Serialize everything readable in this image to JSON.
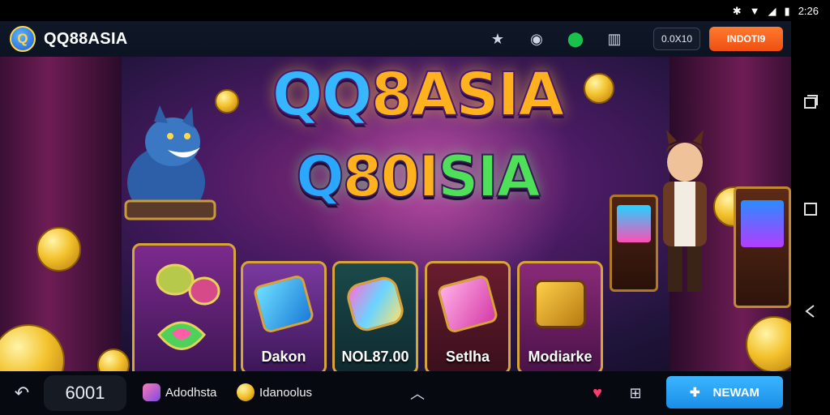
{
  "status_bar": {
    "time": "2:26",
    "icons": [
      "bluetooth-icon",
      "wifi-icon",
      "signal-icon",
      "battery-icon"
    ]
  },
  "header": {
    "logo_initial": "Q",
    "app_title": "QQ88ASIA",
    "icons": [
      "star-icon",
      "chat-icon",
      "notification-icon",
      "wallet-icon"
    ],
    "balance": "0.0X10",
    "deposit_label": "INDOTI9"
  },
  "hero": {
    "title_part1": "QQ",
    "title_part2": "8ASIA",
    "subtitle_part1": "Q",
    "subtitle_part2": "80I",
    "subtitle_part3": "SIA"
  },
  "games": [
    {
      "label": "Dakon",
      "icon": "blue-block-icon"
    },
    {
      "label": "NOL87.00",
      "icon": "rainbow-gem-icon"
    },
    {
      "label": "Setlha",
      "icon": "pink-cube-icon"
    },
    {
      "label": "Modiarke",
      "icon": "speaker-machine-icon"
    }
  ],
  "bottom_bar": {
    "count": "6001",
    "user_chip": "Adodhsta",
    "promo_chip": "Idanoolus",
    "new_label": "NEWAM"
  },
  "colors": {
    "accent_orange": "#ef4f10",
    "accent_blue": "#1a8ee8",
    "title_gold": "#ffb21e",
    "title_green": "#4fe05a"
  }
}
